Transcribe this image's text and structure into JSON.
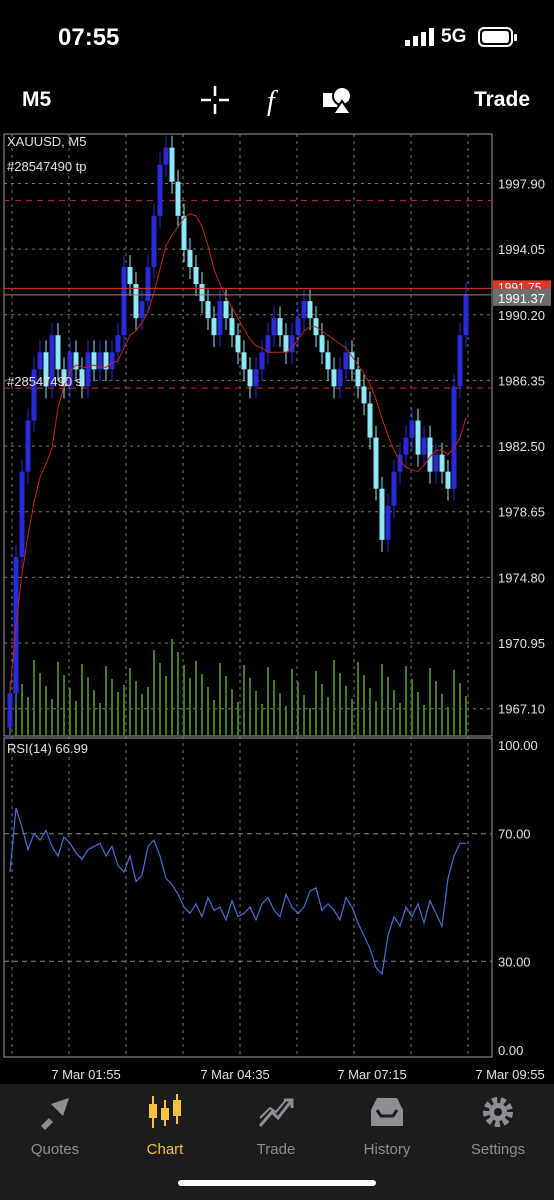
{
  "status_bar": {
    "time": "07:55",
    "network": "5G"
  },
  "toolbar": {
    "timeframe": "M5",
    "trade_label": "Trade",
    "icons": [
      "crosshair-icon",
      "function-icon",
      "objects-icon"
    ]
  },
  "chart": {
    "symbol_label": "XAUUSD, M5",
    "tp_label": "#28547490 tp",
    "sl_label": "#28547490 sl",
    "current_price": "1991.37",
    "ask_price": "1991.75",
    "price_ticks": [
      "1997.90",
      "1994.05",
      "1990.20",
      "1986.35",
      "1982.50",
      "1978.65",
      "1974.80",
      "1970.95",
      "1967.10"
    ],
    "indicator_label": "RSI(14) 66.99",
    "rsi_ticks": [
      "100.00",
      "70.00",
      "30.00",
      "0.00"
    ],
    "time_ticks": [
      "7 Mar 01:55",
      "7 Mar 04:35",
      "7 Mar 07:15",
      "7 Mar 09:55"
    ],
    "colors": {
      "bull": "#2a2ad8",
      "bear": "#8ee8f8",
      "ma": "#c0241c",
      "tp_sl": "#b0241c",
      "rsi": "#4a6fd4",
      "volume": "#3f7a26"
    }
  },
  "chart_data": {
    "type": "candlestick",
    "symbol": "XAUUSD",
    "timeframe": "M5",
    "x_range": [
      "7 Mar 00:40",
      "7 Mar 10:10"
    ],
    "y_range": [
      1965.5,
      2000.8
    ],
    "take_profit": 1996.9,
    "stop_loss": 1985.9,
    "bid": 1991.37,
    "ask": 1991.75,
    "close": [
      1968,
      1976,
      1981,
      1984,
      1987,
      1988,
      1986,
      1989,
      1987,
      1986,
      1988,
      1987,
      1986,
      1988,
      1987,
      1988,
      1987,
      1988,
      1989,
      1993,
      1992,
      1990,
      1991,
      1993,
      1996,
      1999,
      2000,
      1998,
      1996,
      1994,
      1993,
      1992,
      1991,
      1990,
      1989,
      1991,
      1990,
      1989,
      1988,
      1987,
      1986,
      1987,
      1988,
      1989,
      1990,
      1989,
      1988,
      1989,
      1990,
      1991,
      1990,
      1989,
      1988,
      1987,
      1986,
      1987,
      1988,
      1987,
      1986,
      1985,
      1983,
      1980,
      1977,
      1979,
      1981,
      1982,
      1983,
      1984,
      1982,
      1983,
      1981,
      1982,
      1981,
      1980,
      1986,
      1989,
      1991.4
    ],
    "ma_period_note": "",
    "rsi": {
      "label": "RSI(14)",
      "last": 66.99,
      "levels": [
        30,
        70
      ],
      "range": [
        0,
        100
      ],
      "values": [
        58,
        78,
        72,
        65,
        70,
        68,
        71,
        66,
        63,
        69,
        67,
        64,
        62,
        65,
        66,
        67,
        63,
        66,
        60,
        58,
        63,
        55,
        57,
        66,
        68,
        63,
        56,
        54,
        51,
        47,
        45,
        48,
        44,
        50,
        46,
        47,
        43,
        49,
        44,
        45,
        47,
        43,
        48,
        50,
        46,
        44,
        51,
        47,
        45,
        47,
        52,
        53,
        46,
        48,
        46,
        43,
        50,
        47,
        42,
        38,
        34,
        28,
        26,
        38,
        44,
        41,
        47,
        44,
        48,
        42,
        49,
        45,
        41,
        56,
        63,
        67,
        66.99
      ]
    }
  },
  "tabs": [
    {
      "label": "Quotes",
      "icon": "quotes-icon",
      "active": false
    },
    {
      "label": "Chart",
      "icon": "chart-icon",
      "active": true
    },
    {
      "label": "Trade",
      "icon": "trade-icon",
      "active": false
    },
    {
      "label": "History",
      "icon": "history-icon",
      "active": false
    },
    {
      "label": "Settings",
      "icon": "settings-icon",
      "active": false
    }
  ]
}
